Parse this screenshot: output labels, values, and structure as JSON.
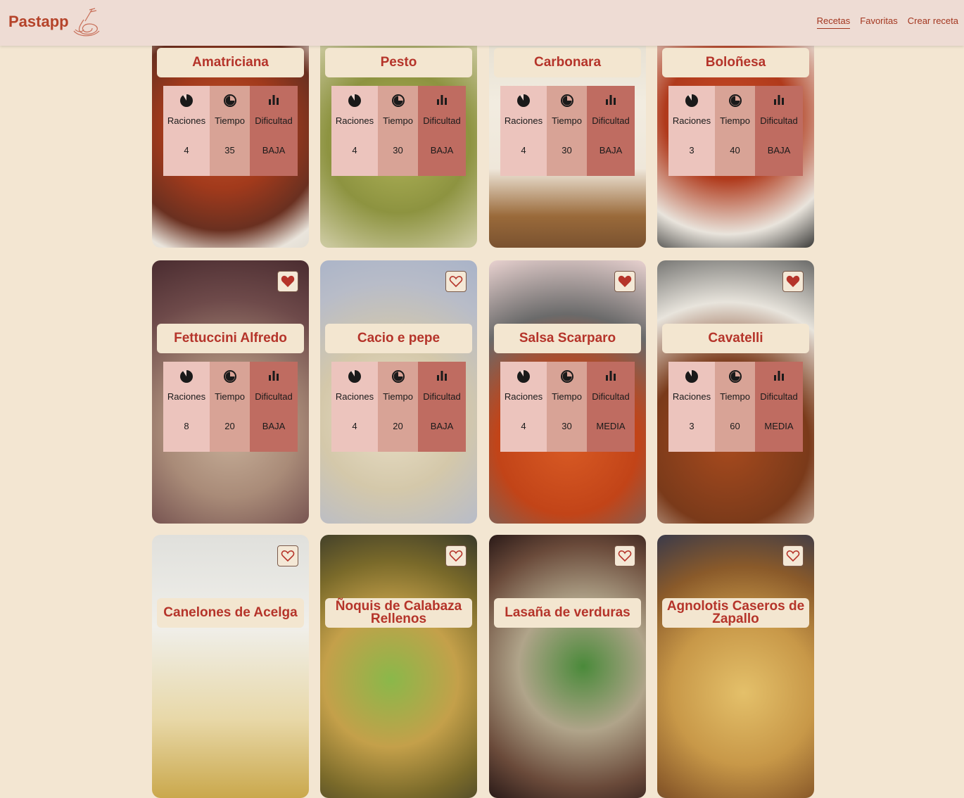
{
  "app": {
    "brand": "Pastapp",
    "logo_icon": "pasta-fork-logo-icon",
    "nav": [
      {
        "label": "Recetas",
        "active": true
      },
      {
        "label": "Favoritas",
        "active": false
      },
      {
        "label": "Crear receta",
        "active": false
      }
    ]
  },
  "labels": {
    "servings": "Raciones",
    "time": "Tiempo",
    "difficulty": "Dificultad"
  },
  "colors": {
    "accent": "#b5342a",
    "header_bg": "#eedcd4",
    "page_bg": "#f3e6d2",
    "stat_servings_bg": "#ecc4bd",
    "stat_time_bg": "#d8a396",
    "stat_difficulty_bg": "#bf6c61"
  },
  "recipes": [
    {
      "title": "Amatriciana",
      "servings": "4",
      "time": "35",
      "difficulty": "BAJA",
      "favorite": null
    },
    {
      "title": "Pesto",
      "servings": "4",
      "time": "30",
      "difficulty": "BAJA",
      "favorite": null
    },
    {
      "title": "Carbonara",
      "servings": "4",
      "time": "30",
      "difficulty": "BAJA",
      "favorite": null
    },
    {
      "title": "Boloñesa",
      "servings": "3",
      "time": "40",
      "difficulty": "BAJA",
      "favorite": null
    },
    {
      "title": "Fettuccini Alfredo",
      "servings": "8",
      "time": "20",
      "difficulty": "BAJA",
      "favorite": true
    },
    {
      "title": "Cacio e pepe",
      "servings": "4",
      "time": "20",
      "difficulty": "BAJA",
      "favorite": false
    },
    {
      "title": "Salsa Scarparo",
      "servings": "4",
      "time": "30",
      "difficulty": "MEDIA",
      "favorite": true
    },
    {
      "title": "Cavatelli",
      "servings": "3",
      "time": "60",
      "difficulty": "MEDIA",
      "favorite": true
    },
    {
      "title": "Canelones de Acelga",
      "favorite": false
    },
    {
      "title": "Ñoquis de Calabaza Rellenos",
      "favorite": false
    },
    {
      "title": "Lasaña de verduras",
      "favorite": false
    },
    {
      "title": "Agnolotis Caseros de Zapallo",
      "favorite": false
    }
  ]
}
